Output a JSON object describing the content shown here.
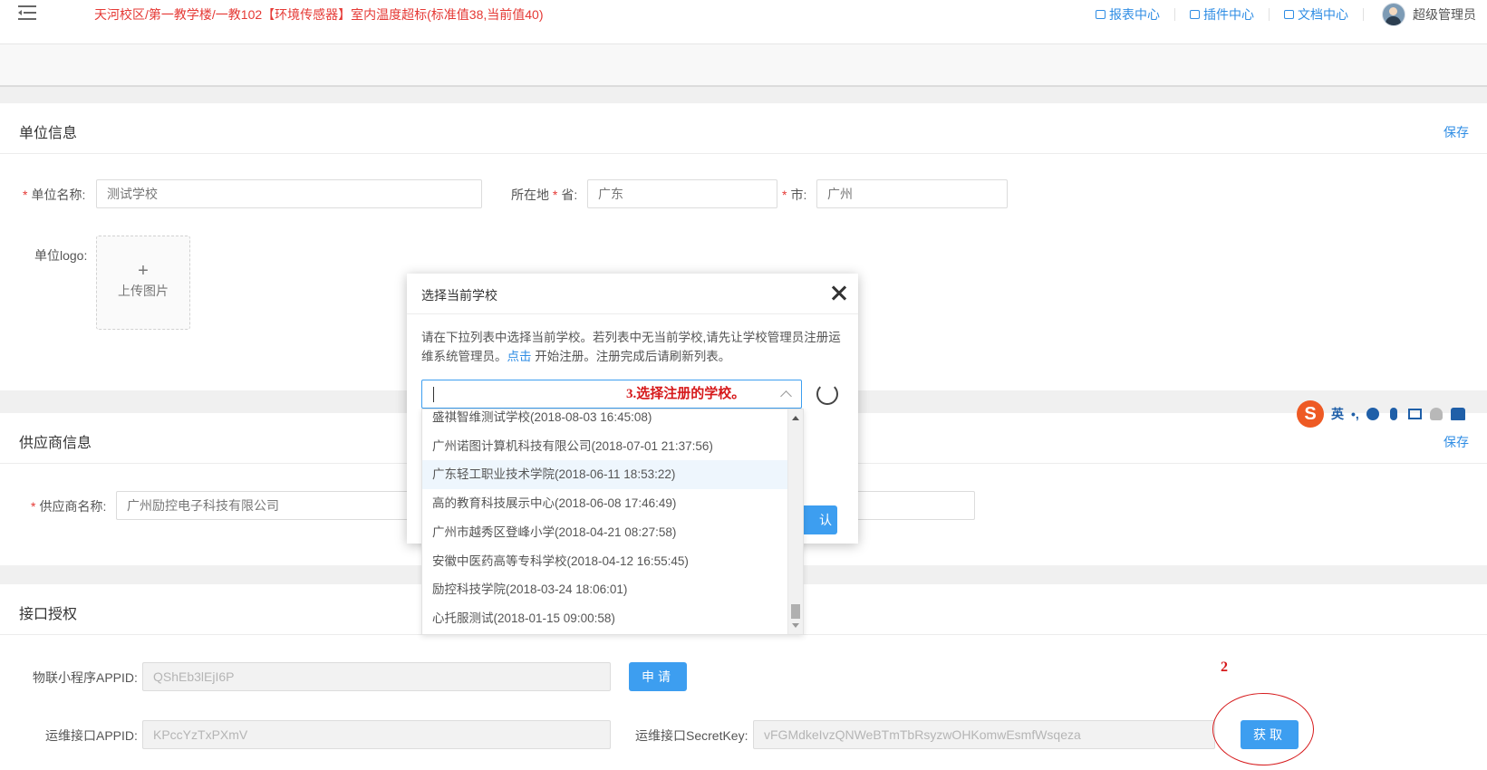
{
  "header": {
    "alert": "天河校区/第一教学楼/一教102【环境传感器】室内温度超标(标准值38,当前值40)",
    "links": [
      "报表中心",
      "插件中心",
      "文档中心"
    ],
    "user": "超级管理员"
  },
  "unit_info": {
    "title": "单位信息",
    "save": "保存",
    "name_label": "单位名称:",
    "name_value": "测试学校",
    "location_label": "所在地",
    "province_label": "省:",
    "province_value": "广东",
    "city_label": "市:",
    "city_value": "广州",
    "logo_label": "单位logo:",
    "upload_plus": "+",
    "upload_text": "上传图片"
  },
  "supplier_info": {
    "title": "供应商信息",
    "save": "保存",
    "name_label": "供应商名称:",
    "name_value": "广州励控电子科技有限公司"
  },
  "api_auth": {
    "title": "接口授权",
    "mini_appid_label": "物联小程序APPID:",
    "mini_appid_value": "QShEb3lEjI6P",
    "apply_button": "申请",
    "ops_appid_label": "运维接口APPID:",
    "ops_appid_value": "KPccYzTxPXmV",
    "ops_secret_label": "运维接口SecretKey:",
    "ops_secret_value": "vFGMdkeIvzQNWeBTmTbRsyzwOHKomwEsmfWsqeza",
    "get_button": "获取"
  },
  "annotations": {
    "step2": "2",
    "step3": "3.选择注册的学校。"
  },
  "modal": {
    "title": "选择当前学校",
    "desc_1": "请在下拉列表中选择当前学校。若列表中无当前学校,请先让学校管理员注册运维系统管理员。",
    "desc_link": "点击",
    "desc_2": " 开始注册。注册完成后请刷新列表。",
    "confirm_button_partial": "认"
  },
  "dropdown": {
    "options": [
      "盛祺智维测试学校(2018-08-03 16:45:08)",
      "广州诺图计算机科技有限公司(2018-07-01 21:37:56)",
      "广东轻工职业技术学院(2018-06-11 18:53:22)",
      "高的教育科技展示中心(2018-06-08 17:46:49)",
      "广州市越秀区登峰小学(2018-04-21 08:27:58)",
      "安徽中医药高等专科学校(2018-04-12 16:55:45)",
      "励控科技学院(2018-03-24 18:06:01)",
      "心托服测试(2018-01-15 09:00:58)"
    ],
    "highlighted_index": 2
  },
  "ime": {
    "logo": "S",
    "lang": "英",
    "punct": "•,"
  },
  "colors": {
    "accent": "#3d9ef0",
    "alert_red": "#e53935",
    "annotation_red": "#d6191b"
  }
}
